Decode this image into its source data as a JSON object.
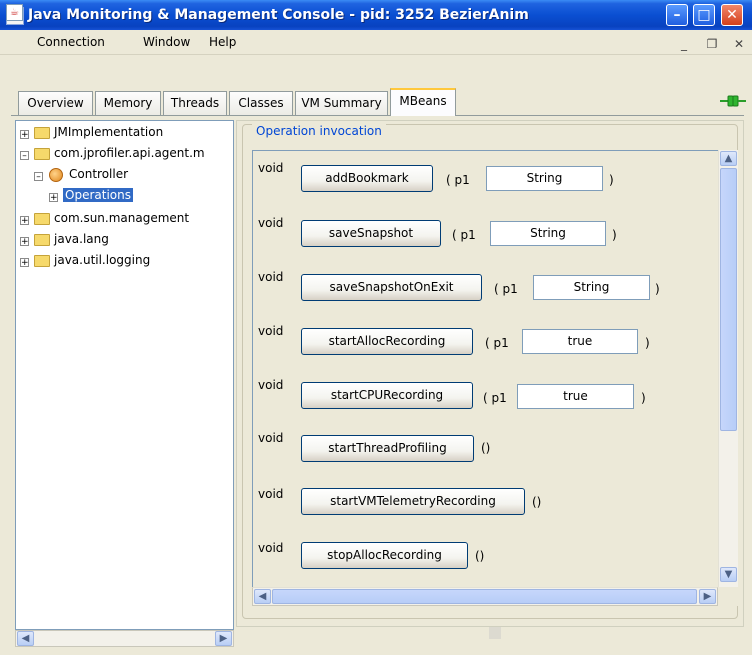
{
  "window": {
    "title": "Java Monitoring & Management Console - pid: 3252 BezierAnim",
    "icon": "java-cup-icon"
  },
  "menu": {
    "items": [
      "Connection",
      "Window",
      "Help"
    ]
  },
  "tabs": [
    "Overview",
    "Memory",
    "Threads",
    "Classes",
    "VM Summary",
    "MBeans"
  ],
  "active_tab": "MBeans",
  "tree": {
    "nodes": [
      {
        "label": "JMImplementation"
      },
      {
        "label": "com.jprofiler.api.agent.m"
      },
      {
        "label": "Controller"
      },
      {
        "label": "Operations"
      },
      {
        "label": "com.sun.management"
      },
      {
        "label": "java.lang"
      },
      {
        "label": "java.util.logging"
      }
    ],
    "selected": "Operations"
  },
  "operations_panel": {
    "title": "Operation invocation",
    "operations": [
      {
        "return_type": "void",
        "name": "addBookmark",
        "param_label": "( p1",
        "param_value": "String",
        "close": ")"
      },
      {
        "return_type": "void",
        "name": "saveSnapshot",
        "param_label": "( p1",
        "param_value": "String",
        "close": ")"
      },
      {
        "return_type": "void",
        "name": "saveSnapshotOnExit",
        "param_label": "( p1",
        "param_value": "String",
        "close": ")"
      },
      {
        "return_type": "void",
        "name": "startAllocRecording",
        "param_label": "( p1",
        "param_value": "true",
        "close": ")"
      },
      {
        "return_type": "void",
        "name": "startCPURecording",
        "param_label": "( p1",
        "param_value": "true",
        "close": ")"
      },
      {
        "return_type": "void",
        "name": "startThreadProfiling",
        "param_label": "()"
      },
      {
        "return_type": "void",
        "name": "startVMTelemetryRecording",
        "param_label": "()"
      },
      {
        "return_type": "void",
        "name": "stopAllocRecording",
        "param_label": "()"
      }
    ]
  },
  "colors": {
    "titlebar": "#0a4fd2",
    "selection": "#316ac5",
    "group_title": "#0046d5",
    "active_tab_accent": "#ffc83c"
  }
}
